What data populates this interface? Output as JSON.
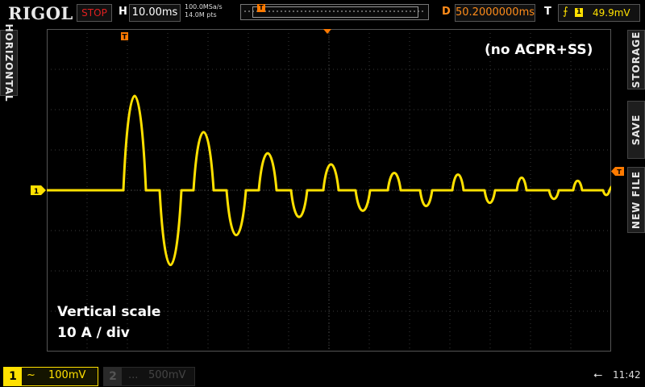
{
  "header": {
    "brand": "RIGOL",
    "run_state": "STOP",
    "h_label": "H",
    "timebase": "10.00ms",
    "sample_rate": "100.0MSa/s",
    "memory_depth": "14.0M pts",
    "d_label": "D",
    "delay": "50.2000000ms",
    "t_label": "T",
    "trigger_channel": "1",
    "trigger_level": "49.9mV"
  },
  "side_tabs": {
    "left": "HORIZONTAL",
    "right": [
      "STORAGE",
      "SAVE",
      "NEW FILE"
    ]
  },
  "annotations": {
    "mode": "(no ACPR+SS)",
    "scale_line1": "Vertical scale",
    "scale_line2": "10 A / div"
  },
  "markers": {
    "channel1_ground": "1",
    "trigger_position": "T"
  },
  "bottom": {
    "ch1_number": "1",
    "ch1_coupling": "~",
    "ch1_scale": "100mV",
    "ch2_number": "2",
    "ch2_coupling": "...",
    "ch2_scale": "500mV",
    "time": "11:42"
  },
  "colors": {
    "trace": "#ffe000",
    "trigger": "#ff7a00",
    "stop": "#e02020",
    "grid": "#3a3a3a"
  }
}
